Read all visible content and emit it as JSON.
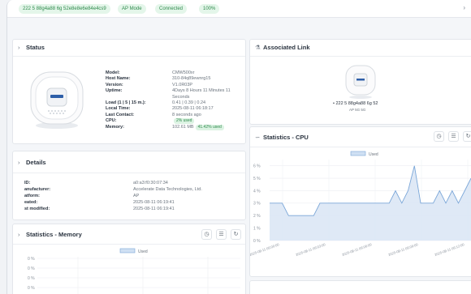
{
  "topbar": {
    "pills": [
      "222 5 88g4a88 6g 52e8e8e6e84e4cs9",
      "AP Mode",
      "Connected",
      "100%"
    ]
  },
  "status": {
    "title": "Status",
    "rows": [
      {
        "key": "Model:",
        "value": "CMW500xr"
      },
      {
        "key": "Host Name:",
        "value": "310-84q89ewnrg15"
      },
      {
        "key": "Version:",
        "value": "V1.0R03P"
      },
      {
        "key": "Uptime:",
        "value": "4Days 8 Hours 11 Minutes 11"
      },
      {
        "key": "",
        "value": "Seconds"
      },
      {
        "key": "Load (1 | 5 | 15 m.):",
        "value": "0.41 | 0.39 | 0.24"
      },
      {
        "key": "Local Time:",
        "value": "2025-08-11 06:18:17"
      },
      {
        "key": "Last Contact:",
        "value": "8 seconds ago"
      },
      {
        "key": "CPU:",
        "value": "",
        "badge": "2% used"
      },
      {
        "key": "Memory:",
        "value": "102.61 MB",
        "badge": "41.42% used"
      }
    ]
  },
  "details": {
    "title": "Details",
    "rows": [
      {
        "key": "ID:",
        "value": "a0:a3:f0:30:07:34"
      },
      {
        "key": "anufacturer:",
        "value": "Accelerate Data Technologies, Ltd."
      },
      {
        "key": "atform:",
        "value": "AP"
      },
      {
        "key": "eated:",
        "value": "2025-08-11 06:19:41"
      },
      {
        "key": "st modified:",
        "value": "2025-08-11 06:19:41"
      }
    ]
  },
  "memory": {
    "title": "Statistics - Memory",
    "legend": "Used",
    "yticks": [
      "0 %",
      "0 %",
      "0 %",
      "0 %"
    ]
  },
  "link": {
    "title": "Associated Link",
    "device_label": "• 222 5 88g4a88 6g 52",
    "device_sub": "AP 5G 5G"
  },
  "cpu": {
    "title": "Statistics - CPU"
  },
  "colors": {
    "accent": "#2f8a4c",
    "chart_line": "#7aa6d8",
    "chart_fill": "#dbe7f5"
  },
  "icons": {
    "status": "chevron-right-icon",
    "link": "network-icon",
    "cpu": "chart-line-icon",
    "history": "clock-icon",
    "menu": "list-icon",
    "refresh": "refresh-icon"
  },
  "chart_data": {
    "type": "area",
    "series": [
      {
        "name": "Used",
        "values": [
          3,
          3,
          3,
          2,
          2,
          2,
          2,
          2,
          3,
          3,
          3,
          3,
          3,
          3,
          3,
          3,
          3,
          3,
          3,
          3,
          4,
          3,
          4,
          6,
          3,
          3,
          3,
          4,
          3,
          4,
          3,
          4,
          5
        ]
      }
    ],
    "x": [
      "2025-08-11 06:00:00",
      "2025-08-11 06:03:00",
      "2025-08-11 06:06:00",
      "2025-08-11 06:09:00",
      "2025-08-11 06:12:00"
    ],
    "yticks": [
      "6 %",
      "5 %",
      "4 %",
      "3 %",
      "2 %",
      "1 %",
      "0 %"
    ],
    "ylim": [
      0,
      6.5
    ],
    "grid": true,
    "legend": "top"
  }
}
